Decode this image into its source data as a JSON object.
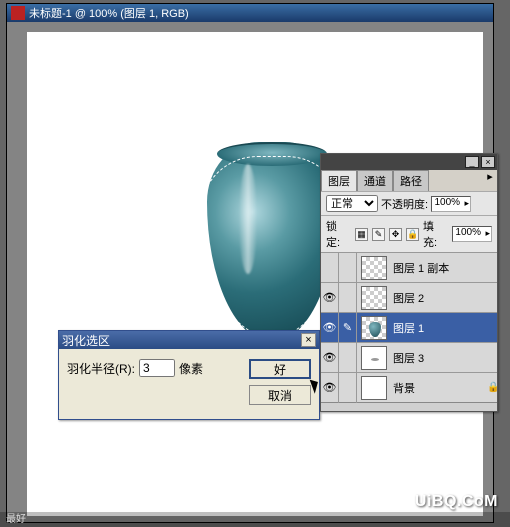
{
  "window": {
    "title": "未标题-1 @ 100% (图层 1, RGB)"
  },
  "dialog": {
    "title": "羽化选区",
    "radius_label": "羽化半径(R):",
    "radius_value": "3",
    "unit": "像素",
    "ok": "好",
    "cancel": "取消"
  },
  "panel": {
    "tabs": [
      "图层",
      "通道",
      "路径"
    ],
    "blend_mode": "正常",
    "opacity_label": "不透明度:",
    "opacity_value": "100%",
    "lock_label": "锁定:",
    "fill_label": "填充:",
    "fill_value": "100%",
    "layers": [
      {
        "name": "图层 1 副本",
        "visible": false,
        "selected": false,
        "thumb": "checker"
      },
      {
        "name": "图层 2",
        "visible": true,
        "selected": false,
        "thumb": "checker"
      },
      {
        "name": "图层 1",
        "visible": true,
        "selected": true,
        "thumb": "vase"
      },
      {
        "name": "图层 3",
        "visible": true,
        "selected": false,
        "thumb": "blank"
      },
      {
        "name": "背景",
        "visible": true,
        "selected": false,
        "thumb": "white",
        "locked": true
      }
    ]
  },
  "watermark": "UiBQ.CoM",
  "footer": "最好"
}
